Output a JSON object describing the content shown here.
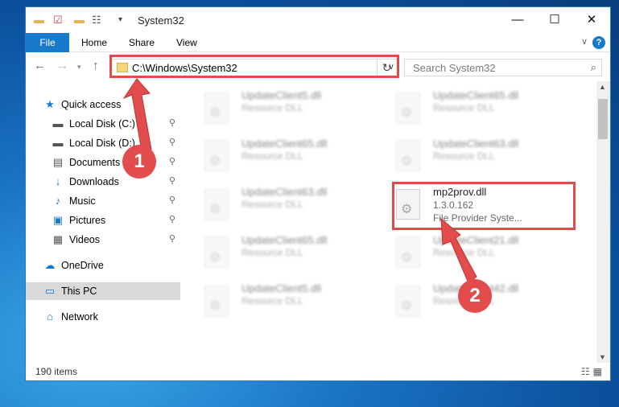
{
  "window": {
    "title": "System32",
    "controls": {
      "minimize": "—",
      "maximize": "☐",
      "close": "✕"
    }
  },
  "ribbon": {
    "tabs": [
      "File",
      "Home",
      "Share",
      "View"
    ],
    "help": "?"
  },
  "address": {
    "path": "C:\\Windows\\System32",
    "search_placeholder": "Search System32"
  },
  "sidebar": {
    "items": [
      {
        "label": "Quick access",
        "icon": "star-icon",
        "pinned": false
      },
      {
        "label": "Local Disk (C:)",
        "icon": "drive-icon",
        "pinned": true
      },
      {
        "label": "Local Disk (D:)",
        "icon": "drive-icon",
        "pinned": true
      },
      {
        "label": "Documents",
        "icon": "documents-icon",
        "pinned": true
      },
      {
        "label": "Downloads",
        "icon": "download-icon",
        "pinned": true
      },
      {
        "label": "Music",
        "icon": "music-icon",
        "pinned": true
      },
      {
        "label": "Pictures",
        "icon": "pictures-icon",
        "pinned": true
      },
      {
        "label": "Videos",
        "icon": "videos-icon",
        "pinned": true
      },
      {
        "label": "OneDrive",
        "icon": "cloud-icon",
        "pinned": false
      },
      {
        "label": "This PC",
        "icon": "computer-icon",
        "pinned": false,
        "selected": true
      },
      {
        "label": "Network",
        "icon": "network-icon",
        "pinned": false
      }
    ]
  },
  "files": {
    "left": [
      {
        "name": "UpdateClient5.dll",
        "type": "Resource DLL"
      },
      {
        "name": "UpdateClient65.dll",
        "type": "Resource DLL"
      },
      {
        "name": "UpdateClient63.dll",
        "type": "Resource DLL"
      },
      {
        "name": "UpdateClient65.dll",
        "type": "Resource DLL"
      },
      {
        "name": "UpdateClient5.dll",
        "type": "Resource DLL"
      }
    ],
    "right": [
      {
        "name": "UpdateClient65.dll",
        "type": "Resource DLL"
      },
      {
        "name": "UpdateClient63.dll",
        "type": "Resource DLL"
      },
      {
        "name": "UpdateClient21.dll",
        "type": "Resource DLL"
      },
      {
        "name": "UpdateClient42.dll",
        "type": "Resource DLL"
      }
    ],
    "highlighted": {
      "name": "mp2prov.dll",
      "version": "1.3.0.162",
      "description": "File Provider Syste..."
    }
  },
  "status": {
    "item_count": "190 items"
  },
  "callouts": [
    "1",
    "2"
  ],
  "colors": {
    "accent": "#1979ca",
    "highlight": "#e04b4b",
    "selected": "#d9d9d9"
  }
}
